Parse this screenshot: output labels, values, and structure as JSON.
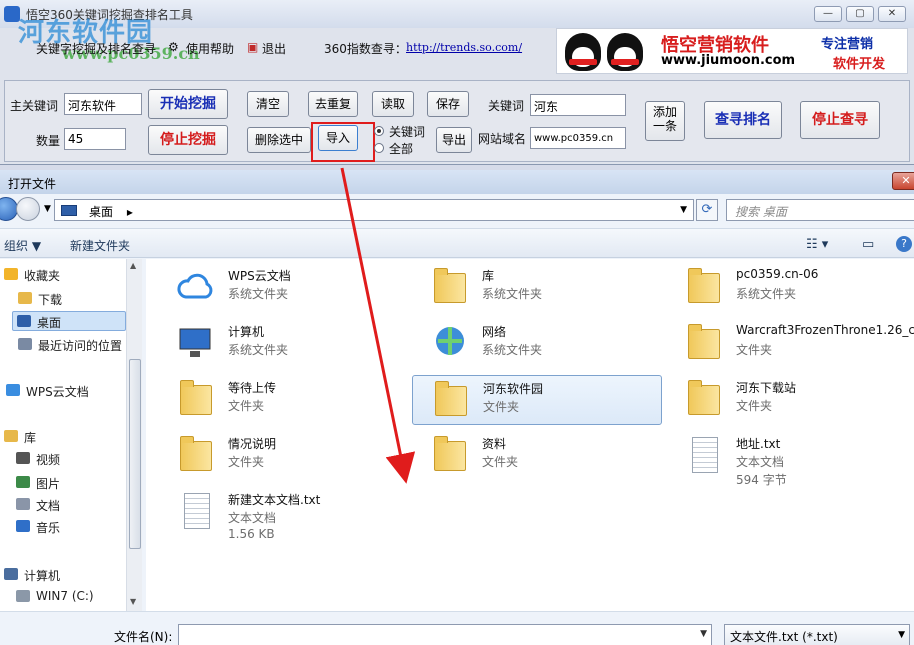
{
  "app": {
    "title": "悟空360关键词挖掘查排名工具",
    "watermark": "河东软件园",
    "watermark_url": "www.pc0359.cn",
    "menu": {
      "keyword_mining": "关键字挖掘及排名查寻",
      "help": "使用帮助",
      "exit": "退出",
      "trend_label": "360指数查寻：",
      "trend_url": "http://trends.so.com/"
    },
    "banner": {
      "brand": "悟空营销软件",
      "site": "www.jiumoon.com",
      "slogan1": "专注营销",
      "slogan2": "软件开发"
    },
    "form": {
      "main_keyword_label": "主关键词",
      "main_keyword_value": "河东软件",
      "count_label": "数量",
      "count_value": "45",
      "start_mining": "开始挖掘",
      "stop_mining": "停止挖掘",
      "clear": "清空",
      "dedupe": "去重复",
      "read": "读取",
      "save": "保存",
      "delete_selected": "删除选中",
      "import": "导入",
      "export": "导出",
      "radio_keyword": "关键词",
      "radio_all": "全部",
      "keyword_label": "关键词",
      "keyword_value": "河东",
      "domain_label": "网站域名",
      "domain_value": "www.pc0359.cn",
      "add_one": "添加一条",
      "query_rank": "查寻排名",
      "stop_query": "停止查寻"
    }
  },
  "dialog": {
    "title": "打开文件",
    "address": "桌面",
    "search_placeholder": "搜索 桌面",
    "toolbar": {
      "organize": "组织 ▼",
      "new_folder": "新建文件夹"
    },
    "sidebar": [
      {
        "label": "收藏夹",
        "icon": "star-icon"
      },
      {
        "label": "下载",
        "icon": "download-folder-icon"
      },
      {
        "label": "桌面",
        "icon": "desktop-icon",
        "selected": true
      },
      {
        "label": "最近访问的位置",
        "icon": "recent-icon"
      },
      {
        "label": "WPS云文档",
        "icon": "cloud-icon"
      },
      {
        "label": "库",
        "icon": "library-icon"
      },
      {
        "label": "视频",
        "icon": "video-icon"
      },
      {
        "label": "图片",
        "icon": "picture-icon"
      },
      {
        "label": "文档",
        "icon": "document-icon"
      },
      {
        "label": "音乐",
        "icon": "music-icon"
      },
      {
        "label": "计算机",
        "icon": "computer-icon"
      },
      {
        "label": "WIN7 (C:)",
        "icon": "drive-icon"
      }
    ],
    "files": [
      {
        "name": "WPS云文档",
        "type": "系统文件夹",
        "icon": "cloud-icon"
      },
      {
        "name": "库",
        "type": "系统文件夹",
        "icon": "library-icon"
      },
      {
        "name": "pc0359.cn-06",
        "type": "系统文件夹",
        "icon": "user-folder-icon"
      },
      {
        "name": "计算机",
        "type": "系统文件夹",
        "icon": "computer-icon"
      },
      {
        "name": "网络",
        "type": "系统文件夹",
        "icon": "network-icon"
      },
      {
        "name": "Warcraft3FrozenThrone1.26_chs",
        "type": "文件夹",
        "icon": "folder-icon"
      },
      {
        "name": "等待上传",
        "type": "文件夹",
        "icon": "folder-icon"
      },
      {
        "name": "河东软件园",
        "type": "文件夹",
        "icon": "folder-icon",
        "selected": true
      },
      {
        "name": "河东下载站",
        "type": "文件夹",
        "icon": "folder-icon"
      },
      {
        "name": "情况说明",
        "type": "文件夹",
        "icon": "folder-icon"
      },
      {
        "name": "资料",
        "type": "文件夹",
        "icon": "folder-icon"
      },
      {
        "name": "地址.txt",
        "type": "文本文档",
        "size": "594 字节",
        "icon": "text-file-icon"
      },
      {
        "name": "新建文本文档.txt",
        "type": "文本文档",
        "size": "1.56 KB",
        "icon": "text-file-icon"
      }
    ],
    "filename_label": "文件名(N):",
    "filename_value": "",
    "filetype": "文本文件.txt (*.txt)"
  },
  "colors": {
    "accent_red": "#e01c1c",
    "link_blue": "#1a2fb5",
    "selection": "#cfe3f8"
  }
}
